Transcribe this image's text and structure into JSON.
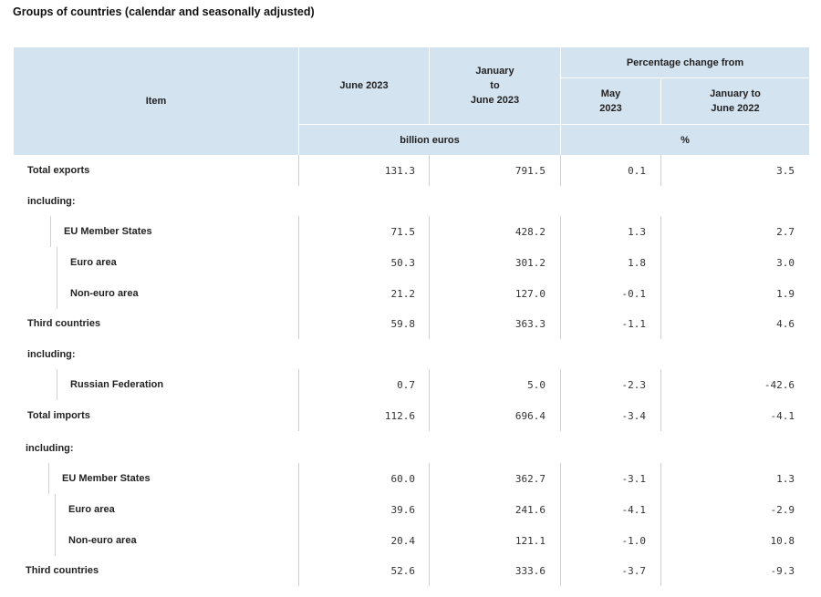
{
  "title": "Groups of countries (calendar and seasonally adjusted)",
  "header": {
    "item": "Item",
    "june": "June 2023",
    "jan_to_june": [
      "January",
      "to",
      "June 2023"
    ],
    "pct_change": "Percentage change from",
    "may": [
      "May",
      "2023"
    ],
    "jan_to_june_2022": [
      "January to",
      "June 2022"
    ],
    "unit_billion": "billion euros",
    "unit_pct": "%"
  },
  "rows": [
    {
      "label": "Total exports",
      "june": "131.3",
      "ytd": "791.5",
      "may": "0.1",
      "prev_ytd": "3.5"
    },
    {
      "label": "including:",
      "june": "",
      "ytd": "",
      "may": "",
      "prev_ytd": ""
    },
    {
      "label": "EU Member States",
      "june": "71.5",
      "ytd": "428.2",
      "may": "1.3",
      "prev_ytd": "2.7"
    },
    {
      "label": "Euro area",
      "june": "50.3",
      "ytd": "301.2",
      "may": "1.8",
      "prev_ytd": "3.0"
    },
    {
      "label": "Non-euro area",
      "june": "21.2",
      "ytd": "127.0",
      "may": "-0.1",
      "prev_ytd": "1.9"
    },
    {
      "label": "Third countries",
      "june": "59.8",
      "ytd": "363.3",
      "may": "-1.1",
      "prev_ytd": "4.6"
    },
    {
      "label": "including:",
      "june": "",
      "ytd": "",
      "may": "",
      "prev_ytd": ""
    },
    {
      "label": "Russian Federation",
      "june": "0.7",
      "ytd": "5.0",
      "may": "-2.3",
      "prev_ytd": "-42.6"
    },
    {
      "label": "Total imports",
      "june": "112.6",
      "ytd": "696.4",
      "may": "-3.4",
      "prev_ytd": "-4.1"
    },
    {
      "label": "including:",
      "june": "",
      "ytd": "",
      "may": "",
      "prev_ytd": ""
    },
    {
      "label": "EU Member States",
      "june": "60.0",
      "ytd": "362.7",
      "may": "-3.1",
      "prev_ytd": "1.3"
    },
    {
      "label": "Euro area",
      "june": "39.6",
      "ytd": "241.6",
      "may": "-4.1",
      "prev_ytd": "-2.9"
    },
    {
      "label": "Non-euro area",
      "june": "20.4",
      "ytd": "121.1",
      "may": "-1.0",
      "prev_ytd": "10.8"
    },
    {
      "label": "Third countries",
      "june": "52.6",
      "ytd": "333.6",
      "may": "-3.7",
      "prev_ytd": "-9.3"
    }
  ]
}
